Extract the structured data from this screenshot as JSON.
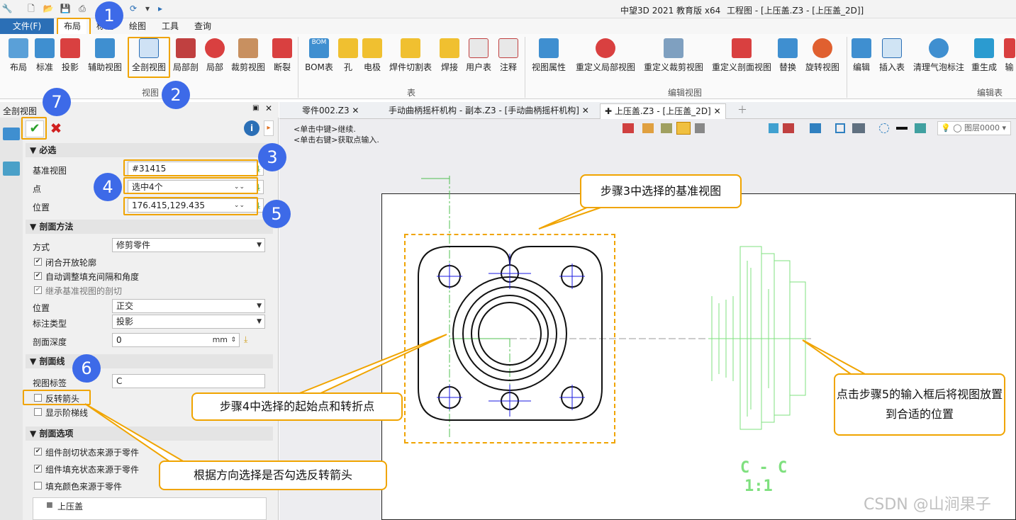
{
  "titlebar": {
    "app": "中望3D 2021 教育版 x64",
    "doc": "工程图 - [上压盖.Z3 - [上压盖_2D]]"
  },
  "menu": {
    "file": "文件(F)",
    "tabs": [
      "布局",
      "标注",
      "绘图",
      "工具",
      "查询"
    ]
  },
  "ribbon": {
    "buttons": [
      "布局",
      "标准",
      "投影",
      "辅助视图",
      "全剖视图",
      "局部剖",
      "局部",
      "裁剪视图",
      "断裂",
      "BOM表",
      "孔",
      "电极",
      "焊件切割表",
      "焊接",
      "用户表",
      "注释",
      "视图属性",
      "重定义局部视图",
      "重定义裁剪视图",
      "重定义剖面视图",
      "替换",
      "旋转视图",
      "编辑",
      "插入表",
      "清理气泡标注",
      "重生成",
      "输"
    ],
    "groups": [
      "视图",
      "表",
      "编辑视图",
      "编辑表"
    ],
    "bom_text": "BOM"
  },
  "panel": {
    "title": "全剖视图",
    "sections": {
      "required": "必选",
      "method": "剖面方法",
      "line": "剖面线",
      "options": "剖面选项"
    },
    "base_view_label": "基准视图",
    "base_view_value": "#31415",
    "point_label": "点",
    "point_value": "选中4个",
    "position_label": "位置",
    "position_value": "176.415,129.435",
    "mode_label": "方式",
    "mode_value": "修剪零件",
    "chk_close": "闭合开放轮廓",
    "chk_auto": "自动调整填充间隔和角度",
    "chk_inherit": "继承基准视图的剖切",
    "pos_label": "位置",
    "pos_value": "正交",
    "anno_label": "标注类型",
    "anno_value": "投影",
    "depth_label": "剖面深度",
    "depth_value": "0",
    "depth_unit": "mm",
    "viewlabel_label": "视图标签",
    "viewlabel_value": "C",
    "chk_reverse": "反转箭头",
    "chk_step": "显示阶梯线",
    "chk_opt1": "组件剖切状态来源于零件",
    "chk_opt2": "组件填充状态来源于零件",
    "chk_opt3": "填充颜色来源于零件",
    "tree_item": "上压盖"
  },
  "tabs": [
    "零件002.Z3",
    "手动曲柄摇杆机构 - 副本.Z3 - [手动曲柄摇杆机构]",
    "上压盖.Z3 - [上压盖_2D]"
  ],
  "hints": [
    "<单击中键>继续.",
    "<单击右键>获取点输入."
  ],
  "layer": "图层0000",
  "section_label": "C - C",
  "scale_label": "1:1",
  "callouts": {
    "c1": "步骤3中选择的基准视图",
    "c2": "步骤4中选择的起始点和转折点",
    "c3": "点击步骤5的输入框后将视图放置到合适的位置",
    "c4": "根据方向选择是否勾选反转箭头"
  },
  "badges": [
    "1",
    "2",
    "3",
    "4",
    "5",
    "6",
    "7"
  ],
  "watermark": "CSDN @山涧果子",
  "colors": {
    "accent": "#2b6fb6",
    "highlight": "#f0a400",
    "badge": "#3d6ae8",
    "projection": "#7fe07f",
    "center": "#1a1ae0"
  }
}
